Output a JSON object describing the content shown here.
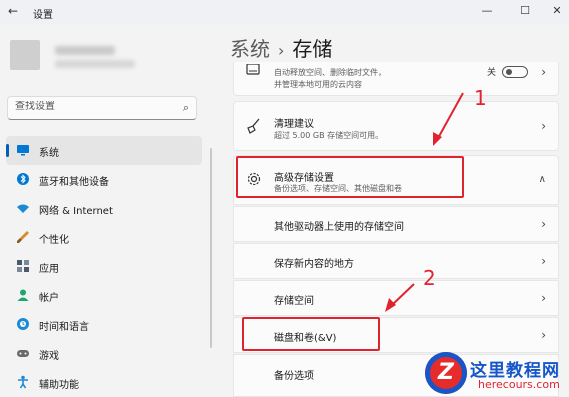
{
  "window": {
    "title": "设置",
    "back_icon": "←",
    "minimize": "—",
    "maximize": "☐",
    "close": "✕"
  },
  "search": {
    "placeholder": "查找设置"
  },
  "sidebar": {
    "items": [
      {
        "label": "系统",
        "icon": "monitor-icon",
        "color": "#0078d4",
        "active": true
      },
      {
        "label": "蓝牙和其他设备",
        "icon": "bluetooth-icon",
        "color": "#0078d4"
      },
      {
        "label": "网络 & Internet",
        "icon": "wifi-icon",
        "color": "#1a8ad4"
      },
      {
        "label": "个性化",
        "icon": "brush-icon",
        "color": "#d88a2c"
      },
      {
        "label": "应用",
        "icon": "apps-icon",
        "color": "#4a5a6a"
      },
      {
        "label": "帐户",
        "icon": "person-icon",
        "color": "#1fa56b"
      },
      {
        "label": "时间和语言",
        "icon": "globe-clock-icon",
        "color": "#1a8ad4"
      },
      {
        "label": "游戏",
        "icon": "gamepad-icon",
        "color": "#6a6a6a"
      },
      {
        "label": "辅助功能",
        "icon": "accessibility-icon",
        "color": "#1a8ad4"
      }
    ]
  },
  "breadcrumb": {
    "parent": "系统",
    "separator": "›",
    "current": "存储"
  },
  "storage_sense": {
    "subtitle_line1": "自动释放空间、删除临时文件，",
    "subtitle_line2": "并管理本地可用的云内容",
    "toggle_label": "关"
  },
  "cleanup": {
    "title": "清理建议",
    "subtitle": "超过 5.00 GB 存储空间可用。"
  },
  "advanced": {
    "title": "高级存储设置",
    "subtitle": "备份选项、存储空间、其他磁盘和卷",
    "chevron": "∧",
    "items": [
      "其他驱动器上使用的存储空间",
      "保存新内容的地方",
      "存储空间",
      "磁盘和卷(&V)",
      "备份选项"
    ]
  },
  "annotations": {
    "step1": "1",
    "step2": "2"
  },
  "watermark": {
    "logo": "Z",
    "name": "这里教程网",
    "url": "herecours.com"
  },
  "colors": {
    "accent": "#005fb8",
    "highlight_red": "#e0242f",
    "watermark_blue": "#1756c9"
  }
}
